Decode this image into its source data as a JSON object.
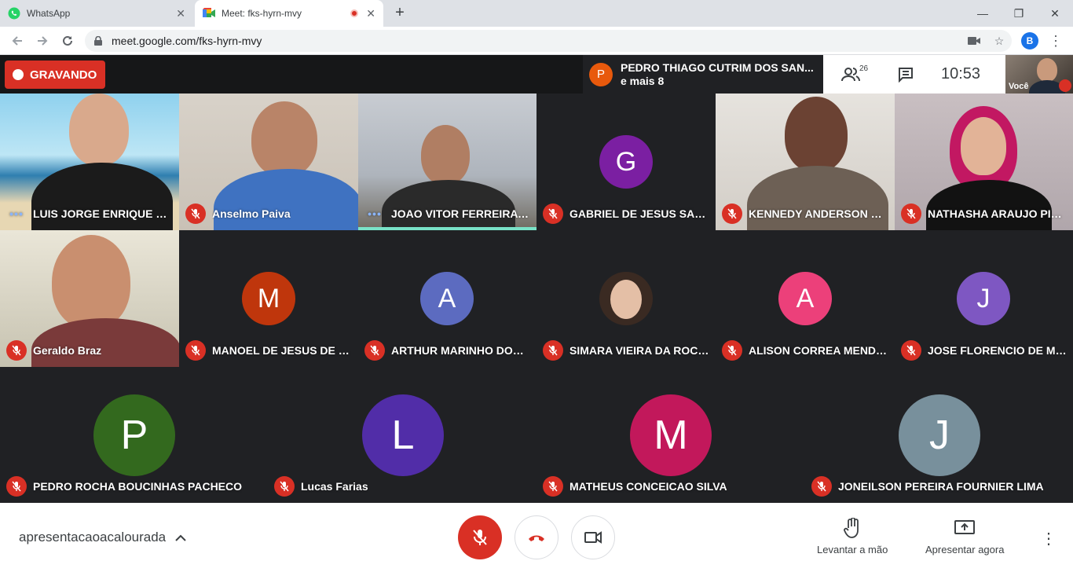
{
  "browser": {
    "tabs": [
      {
        "title": "WhatsApp",
        "active": false
      },
      {
        "title": "Meet: fks-hyrn-mvy",
        "active": true
      }
    ],
    "url": "meet.google.com/fks-hyrn-mvy",
    "profile_initial": "B"
  },
  "meet": {
    "recording_label": "GRAVANDO",
    "presenter": {
      "initial": "P",
      "name": "PEDRO THIAGO CUTRIM DOS SAN...",
      "more": "e mais 8"
    },
    "participant_count": "26",
    "time": "10:53",
    "self_label": "Você",
    "tiles": [
      {
        "name": "LUIS JORGE ENRIQUE RIV...",
        "muted": false,
        "type": "video"
      },
      {
        "name": "Anselmo Paiva",
        "muted": true,
        "type": "video"
      },
      {
        "name": "JOAO VITOR FERREIRA FR...",
        "muted": false,
        "type": "video",
        "speaking": true
      },
      {
        "name": "GABRIEL DE JESUS SANT...",
        "muted": true,
        "type": "avatar",
        "initial": "G",
        "color": "#7b1fa2"
      },
      {
        "name": "KENNEDY ANDERSON ME...",
        "muted": true,
        "type": "video"
      },
      {
        "name": "NATHASHA ARAUJO PINTO",
        "muted": true,
        "type": "video"
      },
      {
        "name": "Geraldo Braz",
        "muted": true,
        "type": "video"
      },
      {
        "name": "MANOEL DE JESUS DE SO...",
        "muted": true,
        "type": "avatar",
        "initial": "M",
        "color": "#bf360c"
      },
      {
        "name": "ARTHUR MARINHO DOS P...",
        "muted": true,
        "type": "avatar",
        "initial": "A",
        "color": "#5c6bc0"
      },
      {
        "name": "SIMARA VIEIRA DA ROCHA",
        "muted": true,
        "type": "photo"
      },
      {
        "name": "ALISON CORREA MENDES",
        "muted": true,
        "type": "avatar",
        "initial": "A",
        "color": "#ec407a"
      },
      {
        "name": "JOSE FLORENCIO DE MEL...",
        "muted": true,
        "type": "avatar",
        "initial": "J",
        "color": "#7e57c2"
      },
      {
        "name": "PEDRO ROCHA BOUCINHAS PACHECO",
        "muted": true,
        "type": "avatar",
        "initial": "P",
        "color": "#33691e"
      },
      {
        "name": "Lucas Farias",
        "muted": true,
        "type": "avatar",
        "initial": "L",
        "color": "#512da8"
      },
      {
        "name": "MATHEUS CONCEICAO SILVA",
        "muted": true,
        "type": "avatar",
        "initial": "M",
        "color": "#c2185b"
      },
      {
        "name": "JONEILSON PEREIRA FOURNIER LIMA",
        "muted": true,
        "type": "avatar",
        "initial": "J",
        "color": "#78909c"
      }
    ]
  },
  "bottom": {
    "meeting_code": "apresentacaoacalourada",
    "raise_hand_label": "Levantar a mão",
    "present_label": "Apresentar agora"
  }
}
